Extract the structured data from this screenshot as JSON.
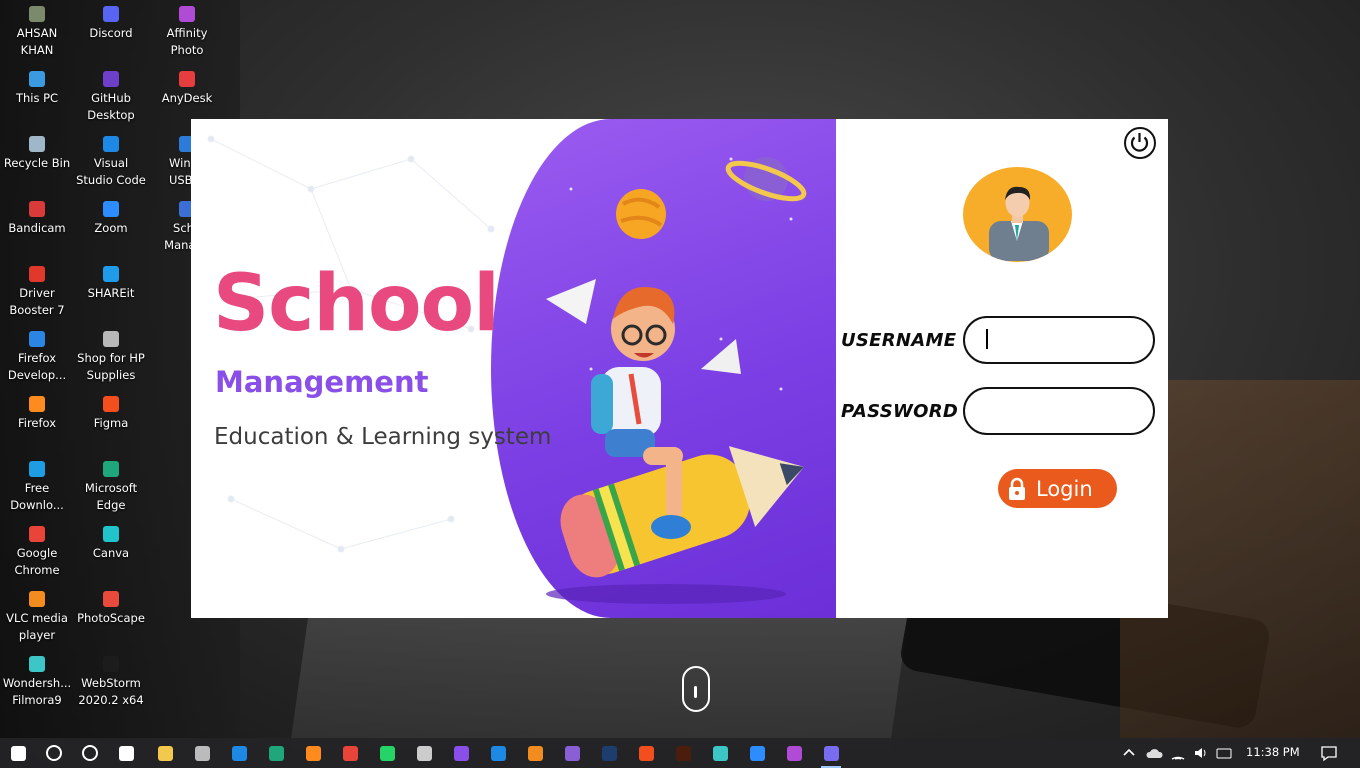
{
  "desktop": {
    "icons": [
      {
        "label": "AHSAN\nKHAN",
        "color": "#7a8a6a"
      },
      {
        "label": "Discord",
        "color": "#5865f2"
      },
      {
        "label": "Affinity\nPhoto",
        "color": "#b04bd6"
      },
      {
        "label": "This PC",
        "color": "#3a9be0"
      },
      {
        "label": "GitHub\nDesktop",
        "color": "#6e40c9"
      },
      {
        "label": "AnyDesk",
        "color": "#e63e3e"
      },
      {
        "label": "Recycle Bin",
        "color": "#9fb7c9"
      },
      {
        "label": "Visual\nStudio Code",
        "color": "#1e88e5"
      },
      {
        "label": "Windo\nUSB D",
        "color": "#2b7bd8"
      },
      {
        "label": "Bandicam",
        "color": "#d93a3a"
      },
      {
        "label": "Zoom",
        "color": "#2d8cff"
      },
      {
        "label": "Scho\nManage",
        "color": "#3b6fd6"
      },
      {
        "label": "Driver\nBooster 7",
        "color": "#e0392c"
      },
      {
        "label": "SHAREit",
        "color": "#1e9be9"
      },
      {
        "label": "Firefox\nDevelop...",
        "color": "#2a86e2"
      },
      {
        "label": "Shop for HP\nSupplies",
        "color": "#b8b8b8"
      },
      {
        "label": "Firefox",
        "color": "#ff8a1e"
      },
      {
        "label": "Figma",
        "color": "#f24e1e"
      },
      {
        "label": "Free\nDownlo...",
        "color": "#1f9de3"
      },
      {
        "label": "Microsoft\nEdge",
        "color": "#1fa67a"
      },
      {
        "label": "Google\nChrome",
        "color": "#e9443a"
      },
      {
        "label": "Canva",
        "color": "#20c4cb"
      },
      {
        "label": "VLC media\nplayer",
        "color": "#f28c1e"
      },
      {
        "label": "PhotoScape",
        "color": "#e84b3c"
      },
      {
        "label": "Wondersh...\nFilmora9",
        "color": "#3cc6c6"
      },
      {
        "label": "WebStorm\n2020.2 x64",
        "color": "#1c1c1c"
      }
    ]
  },
  "banner": {
    "title": "School",
    "subtitle": "Management",
    "tagline": "Education & Learning system"
  },
  "login": {
    "username_label": "USERNAME",
    "password_label": "PASSWORD",
    "username_value": "",
    "password_value": "",
    "login_button": "Login",
    "accent": "#ea5a1c",
    "avatar_bg": "#f8ad2a"
  },
  "taskbar": {
    "apps": [
      "start-icon",
      "search-icon",
      "cortana-icon",
      "task-view-icon",
      "file-explorer-icon",
      "store-icon",
      "mail-icon",
      "edge-icon",
      "firefox-icon",
      "chrome-icon",
      "whatsapp-icon",
      "onedrive-icon",
      "visual-studio-icon",
      "vscode-icon",
      "sublime-icon",
      "github-icon",
      "photoshop-icon",
      "figma-icon",
      "illustrator-icon",
      "app-icon",
      "zoom-icon",
      "affinity-icon",
      "school-app-icon"
    ],
    "time": "11:38 PM"
  }
}
